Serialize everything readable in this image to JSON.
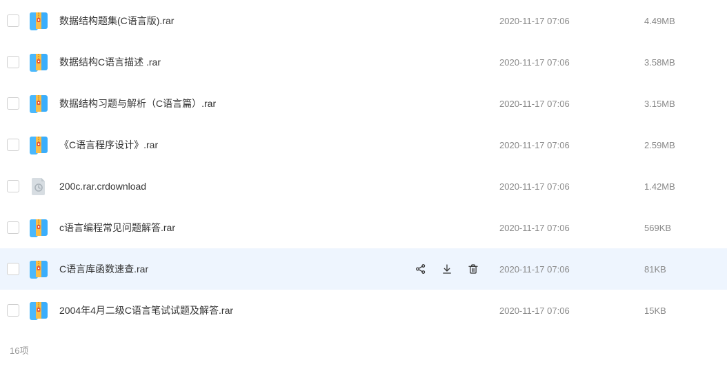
{
  "files": [
    {
      "name": "数据结构题集(C语言版).rar",
      "date": "2020-11-17 07:06",
      "size": "4.49MB",
      "icon": "archive",
      "hovered": false
    },
    {
      "name": "数据结构C语言描述 .rar",
      "date": "2020-11-17 07:06",
      "size": "3.58MB",
      "icon": "archive",
      "hovered": false
    },
    {
      "name": "数据结构习题与解析（C语言篇）.rar",
      "date": "2020-11-17 07:06",
      "size": "3.15MB",
      "icon": "archive",
      "hovered": false
    },
    {
      "name": "《C语言程序设计》.rar",
      "date": "2020-11-17 07:06",
      "size": "2.59MB",
      "icon": "archive",
      "hovered": false
    },
    {
      "name": "200c.rar.crdownload",
      "date": "2020-11-17 07:06",
      "size": "1.42MB",
      "icon": "generic",
      "hovered": false
    },
    {
      "name": "c语言编程常见问题解答.rar",
      "date": "2020-11-17 07:06",
      "size": "569KB",
      "icon": "archive",
      "hovered": false
    },
    {
      "name": "C语言库函数速查.rar",
      "date": "2020-11-17 07:06",
      "size": "81KB",
      "icon": "archive",
      "hovered": true
    },
    {
      "name": "2004年4月二级C语言笔试试题及解答.rar",
      "date": "2020-11-17 07:06",
      "size": "15KB",
      "icon": "archive",
      "hovered": false
    }
  ],
  "footer": {
    "count_label": "16项"
  }
}
